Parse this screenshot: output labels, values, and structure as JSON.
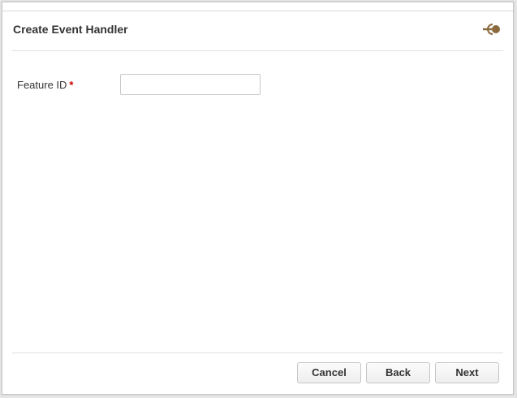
{
  "dialog": {
    "title": "Create Event Handler",
    "icon": "wizard-step-icon"
  },
  "form": {
    "feature_id": {
      "label": "Feature ID",
      "required_marker": "*",
      "value": "",
      "placeholder": ""
    }
  },
  "footer": {
    "cancel_label": "Cancel",
    "back_label": "Back",
    "next_label": "Next"
  },
  "colors": {
    "accent": "#8a6a3c",
    "required": "#cc0000"
  }
}
